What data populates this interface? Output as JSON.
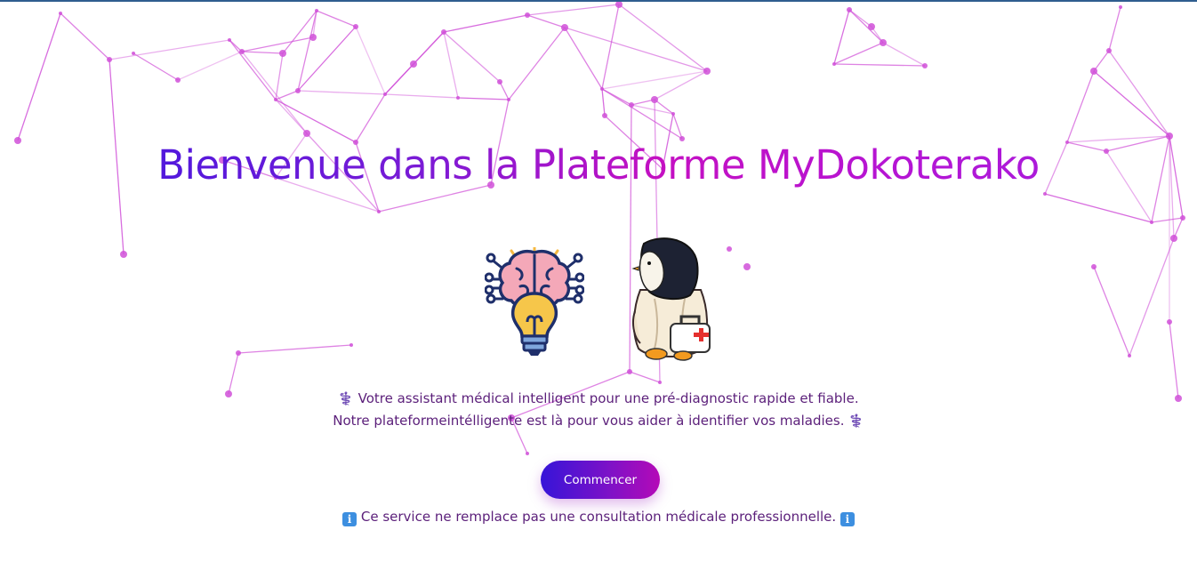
{
  "hero": {
    "title": "Bienvenue dans la Plateforme MyDokoterako"
  },
  "illustrations": {
    "left": "brain-lightbulb-icon",
    "right": "penguin-doctor-icon"
  },
  "tagline": {
    "icon": "⚕️",
    "line1": "Votre assistant médical intelligent pour une pré-diagnostic rapide et fiable.",
    "line2": "Notre plateformeintélligente est là pour vous aider à identifier vos maladies."
  },
  "cta": {
    "label": "Commencer"
  },
  "disclaimer": {
    "icon": "ℹ️",
    "text": "Ce service ne remplace pas une consultation médicale professionnelle."
  },
  "colors": {
    "network": "#d050d8",
    "text": "#5b1f7a",
    "gradient_start": "#3a16e0",
    "gradient_end": "#c410c2"
  }
}
